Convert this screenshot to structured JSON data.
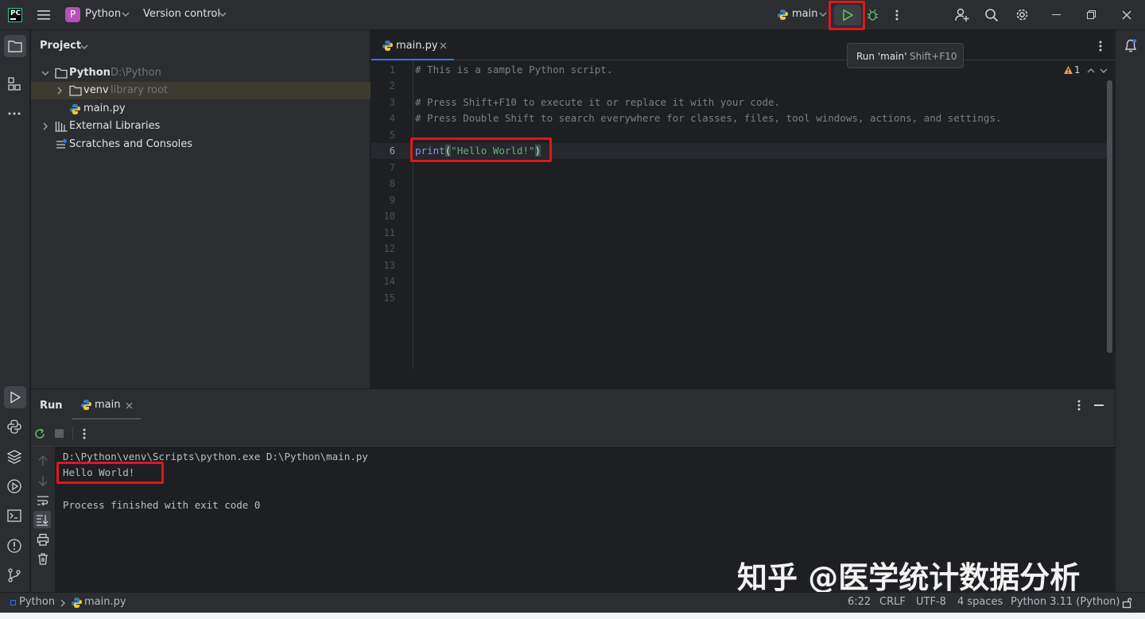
{
  "titlebar": {
    "project_badge": "P",
    "project_name": "Python",
    "vcs_label": "Version control",
    "run_config": "main",
    "tooltip_label": "Run 'main'",
    "tooltip_shortcut": "Shift+F10"
  },
  "project_panel": {
    "title": "Project",
    "tree": [
      {
        "label": "Python",
        "hint": "D:\\Python"
      },
      {
        "label": "venv",
        "hint": "library root"
      },
      {
        "label": "main.py",
        "hint": ""
      },
      {
        "label": "External Libraries",
        "hint": ""
      },
      {
        "label": "Scratches and Consoles",
        "hint": ""
      }
    ]
  },
  "editor": {
    "tab_label": "main.py",
    "warnings_count": "1",
    "line_numbers": [
      "1",
      "2",
      "3",
      "4",
      "5",
      "6",
      "7",
      "8",
      "9",
      "10",
      "11",
      "12",
      "13",
      "14",
      "15"
    ],
    "lines": {
      "l1": "# This is a sample Python script.",
      "l3": "# Press Shift+F10 to execute it or replace it with your code.",
      "l4": "# Press Double Shift to search everywhere for classes, files, tool windows, actions, and settings.",
      "l6_func": "print",
      "l6_open": "(",
      "l6_str": "\"Hello World!\"",
      "l6_close": ")"
    }
  },
  "run_panel": {
    "title": "Run",
    "tab_label": "main",
    "console": [
      "D:\\Python\\venv\\Scripts\\python.exe D:\\Python\\main.py",
      "Hello World!",
      "",
      "Process finished with exit code 0"
    ]
  },
  "watermark": {
    "text": "知乎 @医学统计数据分析"
  },
  "statusbar": {
    "crumb_project": "Python",
    "crumb_file": "main.py",
    "position": "6:22",
    "line_sep": "CRLF",
    "encoding": "UTF-8",
    "indent": "4 spaces",
    "interpreter": "Python 3.11 (Python)"
  },
  "colors": {
    "accent": "#3574f0",
    "run_green": "#5fb865",
    "highlight_red": "#e0161e",
    "warning": "#e6a23c",
    "project_badge": "#b84fbc"
  }
}
